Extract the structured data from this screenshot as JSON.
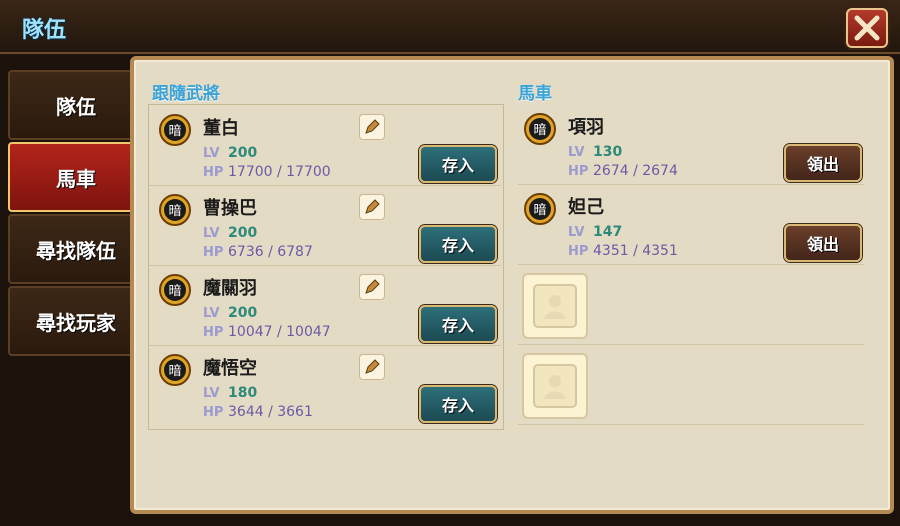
{
  "header": {
    "title": "隊伍"
  },
  "tabs": [
    {
      "label": "隊伍",
      "active": false
    },
    {
      "label": "馬車",
      "active": true
    },
    {
      "label": "尋找隊伍",
      "active": false
    },
    {
      "label": "尋找玩家",
      "active": false
    }
  ],
  "follow": {
    "section_title": "跟隨武將",
    "items": [
      {
        "badge": "暗",
        "name": "董白",
        "lv_label": "LV",
        "lv": "200",
        "hp_label": "HP",
        "hp": "17700 / 17700",
        "button": "存入"
      },
      {
        "badge": "暗",
        "name": "曹操巴",
        "lv_label": "LV",
        "lv": "200",
        "hp_label": "HP",
        "hp": "6736 / 6787",
        "button": "存入"
      },
      {
        "badge": "暗",
        "name": "魔關羽",
        "lv_label": "LV",
        "lv": "200",
        "hp_label": "HP",
        "hp": "10047 / 10047",
        "button": "存入"
      },
      {
        "badge": "暗",
        "name": "魔悟空",
        "lv_label": "LV",
        "lv": "180",
        "hp_label": "HP",
        "hp": "3644 / 3661",
        "button": "存入"
      }
    ]
  },
  "carriage": {
    "section_title": "馬車",
    "items": [
      {
        "badge": "暗",
        "name": "項羽",
        "lv_label": "LV",
        "lv": "130",
        "hp_label": "HP",
        "hp": "2674 / 2674",
        "button": "領出"
      },
      {
        "badge": "暗",
        "name": "妲己",
        "lv_label": "LV",
        "lv": "147",
        "hp_label": "HP",
        "hp": "4351 / 4351",
        "button": "領出"
      }
    ]
  },
  "colors": {
    "active_tab": "#b2251b",
    "section_title": "#3aa3d8",
    "lv_value": "#2c8a7a"
  },
  "icons": {
    "close": "close-icon",
    "edit": "pencil-icon",
    "badge": "dark-element-icon",
    "empty": "empty-slot-icon"
  }
}
